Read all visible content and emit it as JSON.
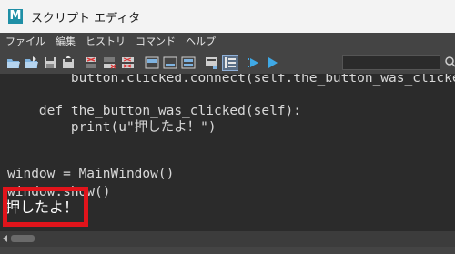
{
  "window": {
    "app_icon_letter": "M",
    "title": "スクリプト エディタ"
  },
  "menu": [
    "ファイル",
    "編集",
    "ヒストリ",
    "コマンド",
    "ヘルプ"
  ],
  "toolbar": {
    "icons": [
      "open-script-icon",
      "source-script-icon",
      "save-script-icon",
      "save-to-shelf-icon",
      "clear-history-icon",
      "clear-input-icon",
      "clear-all-icon",
      "show-history-icon",
      "show-input-icon",
      "show-both-icon",
      "echo-all-commands-icon",
      "line-numbers-icon",
      "execute-all-icon",
      "execute-icon"
    ],
    "search_placeholder": ""
  },
  "editor": {
    "lines": [
      "        button.clicked.connect(self.the_button_was_clicked)",
      "",
      "    def the_button_was_clicked(self):",
      "        print(u\"押したよ！\")",
      "",
      "",
      "window = MainWindow()",
      "window.show()"
    ],
    "output": "押したよ！"
  },
  "colors": {
    "highlight_box": "#e1141b",
    "editor_bg": "#2b2b2b",
    "chrome_bg": "#444444",
    "app_icon": "#1f8fa6"
  }
}
